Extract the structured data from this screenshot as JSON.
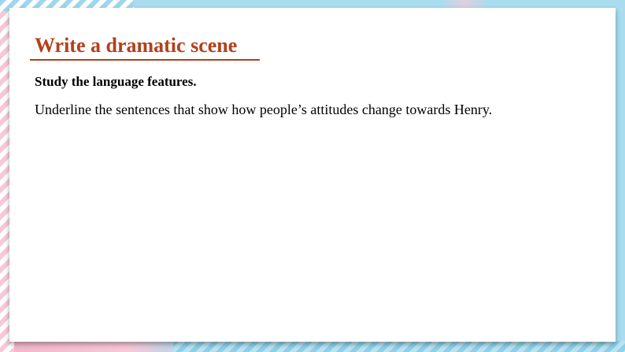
{
  "slide": {
    "title": "Write a dramatic scene",
    "subheading": "Study the language features.",
    "instruction": "Underline the sentences that show how people’s attitudes change towards Henry."
  },
  "colors": {
    "title": "#b3401b",
    "background_blue": "#a9dcef",
    "stripe_pink": "#f7c9d8",
    "stripe_blue": "#9ed6ec"
  }
}
